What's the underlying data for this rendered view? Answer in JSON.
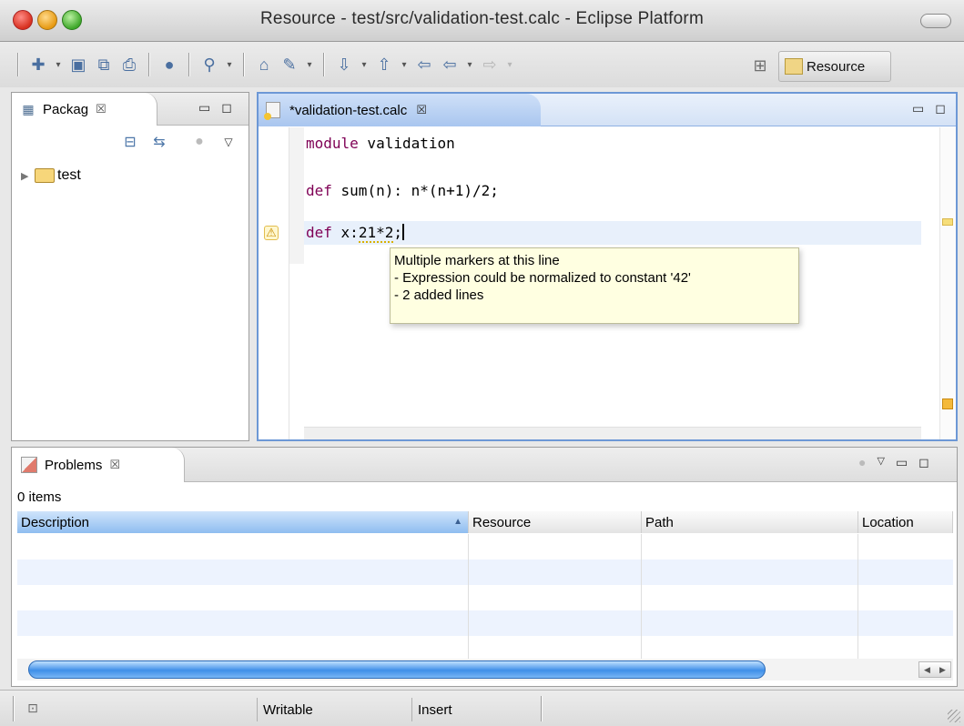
{
  "window": {
    "title": "Resource - test/src/validation-test.calc - Eclipse Platform"
  },
  "toolbar": {
    "icons": [
      "new-wizard-icon",
      "save-icon",
      "save-all-icon",
      "print-icon",
      "globe-icon",
      "run-icon",
      "open-folder-icon",
      "edit-icon",
      "next-annotation-icon",
      "prev-annotation-icon",
      "back-icon",
      "forward-icon"
    ],
    "perspective_label": "Resource"
  },
  "package_explorer": {
    "tab_label": "Packag",
    "close_glyph": "☒",
    "tree": [
      {
        "label": "test",
        "expanded": false
      }
    ]
  },
  "editor": {
    "tab_label": "*validation-test.calc",
    "close_glyph": "☒",
    "code": {
      "line1_kw": "module",
      "line1_rest": " validation",
      "line2_kw": "def",
      "line2_rest": " sum(n): n*(n+1)/2;",
      "line3_kw": "def",
      "line3_pre": " x:",
      "line3_warn": "21*2",
      "line3_post": ";"
    },
    "tooltip": {
      "line1": "Multiple markers at this line",
      "line2": "- Expression could be normalized to constant '42'",
      "line3": "- 2 added lines"
    }
  },
  "problems": {
    "tab_label": "Problems",
    "close_glyph": "☒",
    "count": "0 items",
    "columns": [
      "Description",
      "Resource",
      "Path",
      "Location"
    ],
    "sorted_column": "Description",
    "rows": []
  },
  "statusbar": {
    "writable": "Writable",
    "insert_mode": "Insert"
  },
  "colors": {
    "editor_accent": "#6d98d6",
    "keyword": "#7f0055",
    "tooltip_bg": "#ffffe1",
    "scroll_thumb": "#3f8fe8"
  }
}
